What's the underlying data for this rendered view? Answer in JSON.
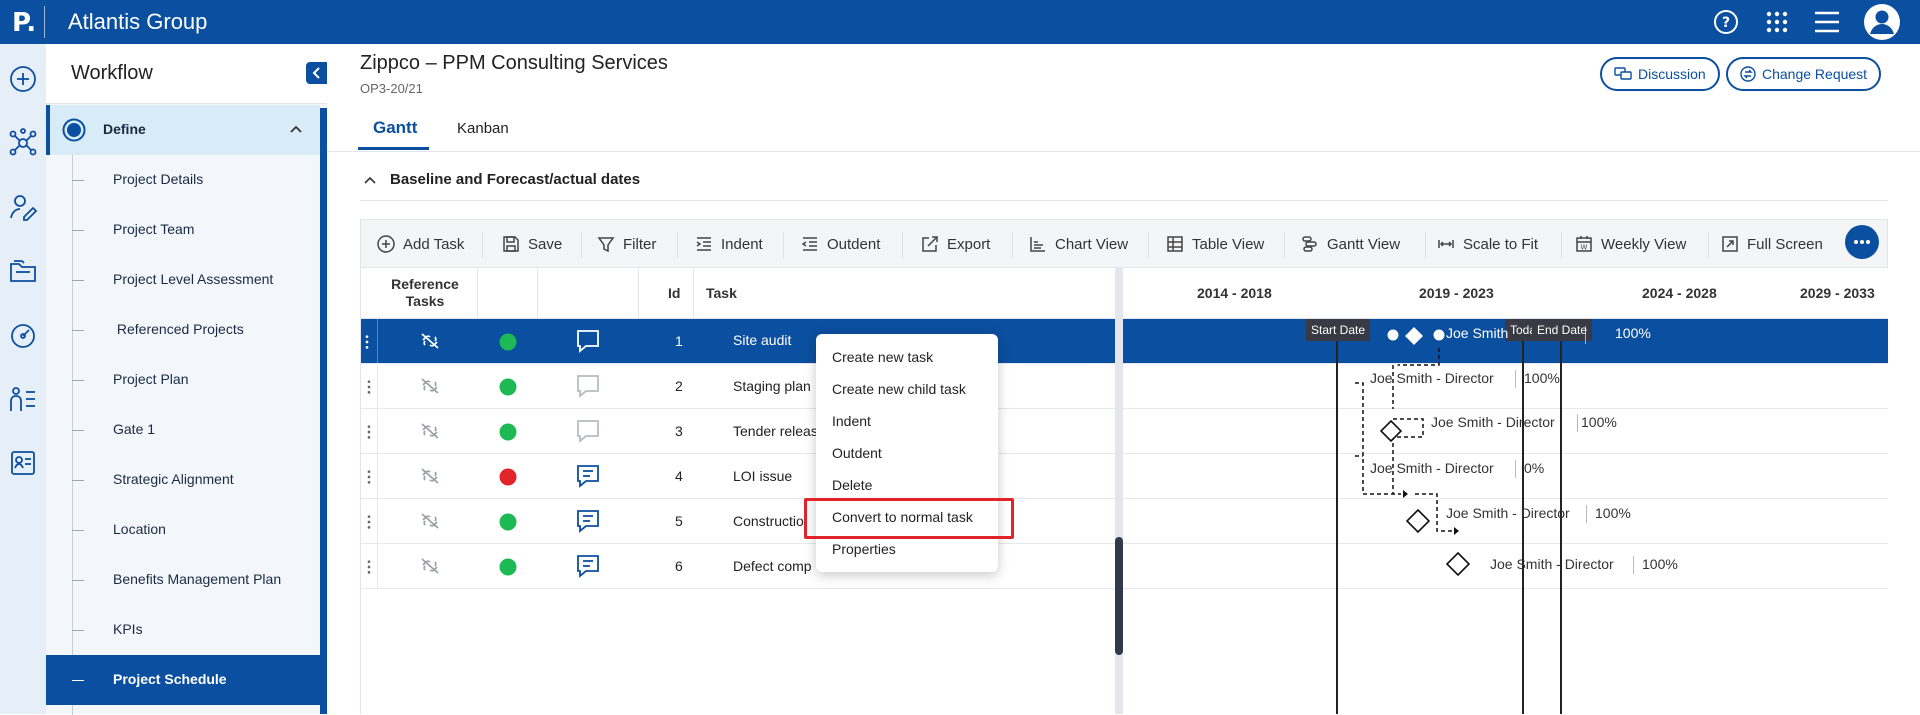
{
  "header": {
    "logo": "P.",
    "app_title": "Atlantis Group"
  },
  "icons": {
    "help": "help-circle-icon",
    "apps": "apps-grid-icon",
    "menu": "hamburger-menu-icon",
    "user": "user-avatar-icon"
  },
  "rail": [
    "add-icon",
    "network-icon",
    "user-edit-icon",
    "folder-icon",
    "dashboard-gauge-icon",
    "people-list-icon",
    "id-card-icon"
  ],
  "workflow": {
    "title": "Workflow",
    "stage": "Define",
    "items": [
      "Project Details",
      "Project Team",
      "Project Level Assessment",
      " Referenced Projects",
      "Project Plan",
      "Gate 1",
      "Strategic Alignment",
      "Location",
      "Benefits Management Plan",
      "KPIs",
      "Project Schedule"
    ],
    "active_item": "Project Schedule"
  },
  "project": {
    "title": "Zippco – PPM Consulting Services",
    "code": "OP3-20/21"
  },
  "actions": {
    "discussion": "Discussion",
    "change_request": "Change Request"
  },
  "tabs": [
    "Gantt",
    "Kanban"
  ],
  "section": "Baseline and Forecast/actual dates",
  "toolbar": [
    "Add Task",
    "Save",
    "Filter",
    "Indent",
    "Outdent",
    "Export",
    "Chart View",
    "Table View",
    "Gantt View",
    "Scale to Fit",
    "Weekly View",
    "Full Screen"
  ],
  "grid": {
    "headers": {
      "ref_line1": "Reference",
      "ref_line2": "Tasks",
      "id": "Id",
      "task": "Task"
    },
    "rows": [
      {
        "id": "1",
        "task": "Site audit",
        "status": "green",
        "comment": "bubble-empty",
        "selected": true
      },
      {
        "id": "2",
        "task": "Staging plan",
        "status": "green",
        "comment": "bubble-empty-grey"
      },
      {
        "id": "3",
        "task": "Tender releas",
        "status": "green",
        "comment": "bubble-empty-grey"
      },
      {
        "id": "4",
        "task": "LOI issue",
        "status": "red",
        "comment": "bubble-lines"
      },
      {
        "id": "5",
        "task": "Constructio",
        "status": "green",
        "comment": "bubble-lines"
      },
      {
        "id": "6",
        "task": "Defect comp",
        "status": "green",
        "comment": "bubble-lines"
      }
    ]
  },
  "gantt": {
    "periods": [
      "2014 - 2018",
      "2019 - 2023",
      "2024 - 2028",
      "2029 - 2033"
    ],
    "markers": {
      "start": "Start Date",
      "today": "Toda",
      "end": "End Date"
    },
    "rows": [
      {
        "owner": "Joe Smith",
        "pct": "100%"
      },
      {
        "owner": "Joe Smith - Director",
        "pct": "100%"
      },
      {
        "owner": "Joe Smith - Director",
        "pct": "100%"
      },
      {
        "owner": "Joe Smith - Director",
        "pct": "0%"
      },
      {
        "owner": "Joe Smith - Director",
        "pct": "100%"
      },
      {
        "owner": "Joe Smith - Director",
        "pct": "100%"
      }
    ]
  },
  "context_menu": [
    "Create new task",
    "Create new child task",
    "Indent",
    "Outdent",
    "Delete",
    "Convert to normal task",
    "Properties"
  ],
  "colors": {
    "brand": "#0b4fa0",
    "green": "#1db954",
    "red": "#e0242a",
    "highlight": "#e0242a"
  }
}
